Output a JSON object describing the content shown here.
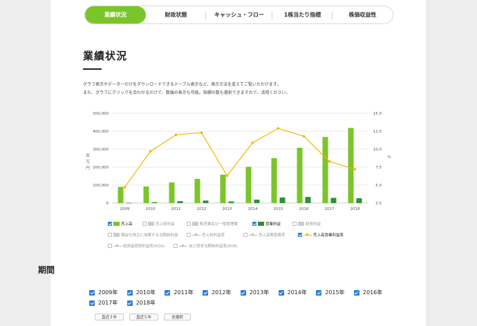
{
  "tabs": [
    {
      "label": "業績状況",
      "active": true
    },
    {
      "label": "財政状態",
      "active": false
    },
    {
      "label": "キャッシュ・フロー",
      "active": false
    },
    {
      "label": "1株当たり指標",
      "active": false
    },
    {
      "label": "株価収益性",
      "active": false
    }
  ],
  "heading": "業績状況",
  "description": [
    "グラフ表示やデーターだけをダウンロードできるテーブル表示など、表示方法を変えてご覧いただけます。",
    "また、グラフにクリックを合わせるだけで、数値の表示も可能。指標の数も選択できますので、活用ください。"
  ],
  "chart_data": {
    "type": "bar",
    "categories": [
      "2009",
      "2010",
      "2011",
      "2012",
      "2013",
      "2014",
      "2015",
      "2016",
      "2017",
      "2018"
    ],
    "series": [
      {
        "name": "売上高",
        "kind": "bar",
        "axis": "left",
        "color": "#7ac529",
        "values": [
          90000,
          92000,
          115000,
          135000,
          158000,
          202000,
          250000,
          308000,
          368000,
          418000
        ]
      },
      {
        "name": "営業利益",
        "kind": "bar",
        "axis": "left",
        "color": "#2f8f3a",
        "values": [
          1500,
          5000,
          11000,
          14000,
          9000,
          19000,
          31000,
          34000,
          29000,
          27000
        ]
      },
      {
        "name": "売上高営業利益率",
        "kind": "line",
        "axis": "right",
        "color": "#f5b400",
        "values": [
          4.7,
          9.7,
          12.0,
          12.3,
          6.3,
          10.9,
          12.9,
          11.8,
          8.3,
          7.2
        ]
      }
    ],
    "ylabel": "百万円",
    "y2label": "%",
    "ylim": [
      0,
      500000
    ],
    "y2lim": [
      2.5,
      15.0
    ],
    "yticks": [
      "500,000",
      "400,000",
      "300,000",
      "200,000",
      "100,000",
      "0"
    ],
    "y2ticks": [
      "15.0",
      "12.5",
      "10.0",
      "7.5",
      "5.0",
      "2.5"
    ],
    "grid": true
  },
  "legend": [
    {
      "label": "売上高",
      "checked": true,
      "type": "bar",
      "color": "#7ac529"
    },
    {
      "label": "売上総利益",
      "checked": false,
      "type": "bar",
      "color": "#cccccc"
    },
    {
      "label": "販売費及び一般管理費",
      "checked": false,
      "type": "bar",
      "color": "#cccccc"
    },
    {
      "label": "営業利益",
      "checked": true,
      "type": "bar",
      "color": "#2f8f3a"
    },
    {
      "label": "経常利益",
      "checked": false,
      "type": "bar",
      "color": "#cccccc"
    },
    {
      "label": "親会社株主に帰属する当期純利益",
      "checked": false,
      "type": "bar",
      "color": "#cccccc"
    },
    {
      "label": "売上総利益率",
      "checked": false,
      "type": "line",
      "color": "#bbbbbb"
    },
    {
      "label": "売上高販管費率",
      "checked": false,
      "type": "line",
      "color": "#bbbbbb"
    },
    {
      "label": "売上高営業利益率",
      "checked": true,
      "type": "line",
      "color": "#f5b400"
    },
    {
      "label": "総資産経常利益率(ROA)",
      "checked": false,
      "type": "line",
      "color": "#bbbbbb"
    },
    {
      "label": "自己資本当期純利益率(ROE)",
      "checked": false,
      "type": "line",
      "color": "#bbbbbb"
    }
  ],
  "period": {
    "heading": "期間",
    "years": [
      {
        "label": "2009年",
        "checked": true
      },
      {
        "label": "2010年",
        "checked": true
      },
      {
        "label": "2011年",
        "checked": true
      },
      {
        "label": "2012年",
        "checked": true
      },
      {
        "label": "2013年",
        "checked": true
      },
      {
        "label": "2014年",
        "checked": true
      },
      {
        "label": "2015年",
        "checked": true
      },
      {
        "label": "2016年",
        "checked": true
      },
      {
        "label": "2017年",
        "checked": true
      },
      {
        "label": "2018年",
        "checked": true
      }
    ],
    "buttons": [
      "直近３年",
      "直近５年",
      "全選択"
    ]
  }
}
